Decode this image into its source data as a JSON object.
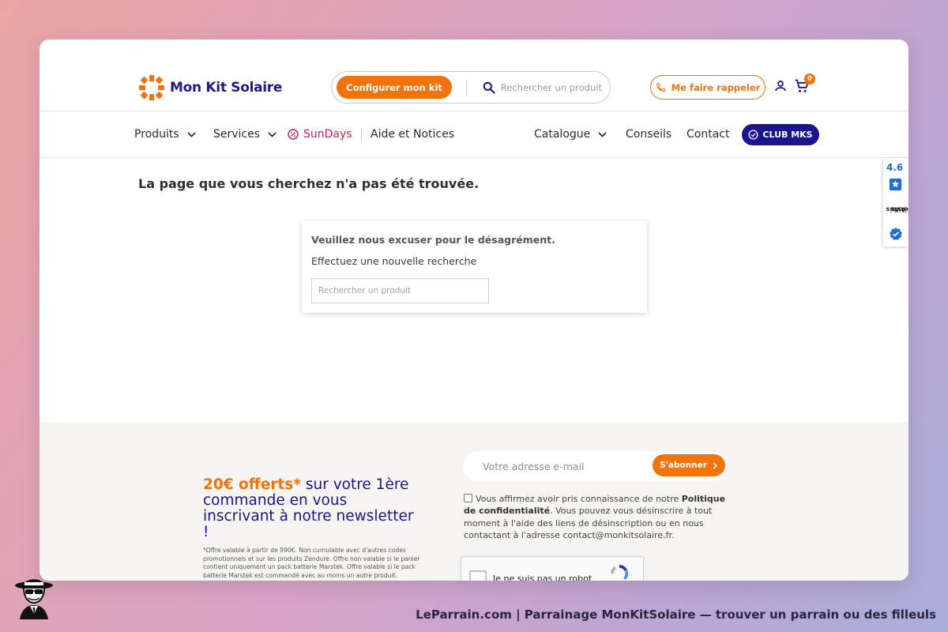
{
  "brand": {
    "name": "Mon Kit Solaire",
    "colors": {
      "primary": "#1b138f",
      "accent": "#f2720c",
      "sundays": "#c0234e"
    }
  },
  "header": {
    "configure_label": "Configurer mon kit",
    "search_placeholder": "Rechercher un produit",
    "callback_label": "Me faire rappeler",
    "cart_count": "0"
  },
  "nav": {
    "items": [
      {
        "label": "Produits"
      },
      {
        "label": "Services"
      },
      {
        "label": "SunDays"
      },
      {
        "label": "Aide et Notices"
      },
      {
        "label": "Catalogue"
      },
      {
        "label": "Conseils"
      },
      {
        "label": "Contact"
      }
    ],
    "club_label": "CLUB MKS"
  },
  "main": {
    "title": "La page que vous cherchez n'a pas été trouvée.",
    "sorry_title": "Veuillez nous excuser pour le désagrément.",
    "sorry_sub": "Effectuez une nouvelle recherche",
    "search_placeholder": "Rechercher un produit"
  },
  "avis_badge": {
    "score": "4.6",
    "label_line1": "Avis",
    "label_line2": "Vérifiés"
  },
  "footer": {
    "promo_accent": "20€ offerts*",
    "promo_text": " sur votre 1ère commande en vous inscrivant à notre newsletter !",
    "promo_fine": "*Offre valable à partir de 990€. Non cumulable avec d'autres codes promotionnels et sur les produits Zendure. Offre non valable si le panier contient uniquement un pack batterie Marstek. Offre valable si le pack batterie Marstek est commandé avec au moins un autre produit.",
    "email_placeholder": "Votre adresse e-mail",
    "subscribe_label": "S'abonner",
    "consent_pre": "Vous affirmez avoir pris connaissance de notre ",
    "consent_bold": "Politique de confidentialité",
    "consent_post": ". Vous pouvez vous désinscrire à tout moment à l'aide des liens de désinscription ou en nous contactant à l'adresse contact@monkitsolaire.fr.",
    "recaptcha_label": "Je ne suis pas un robot"
  },
  "caption": "LeParrain.com | Parrainage MonKitSolaire — trouver un parrain ou des filleuls"
}
